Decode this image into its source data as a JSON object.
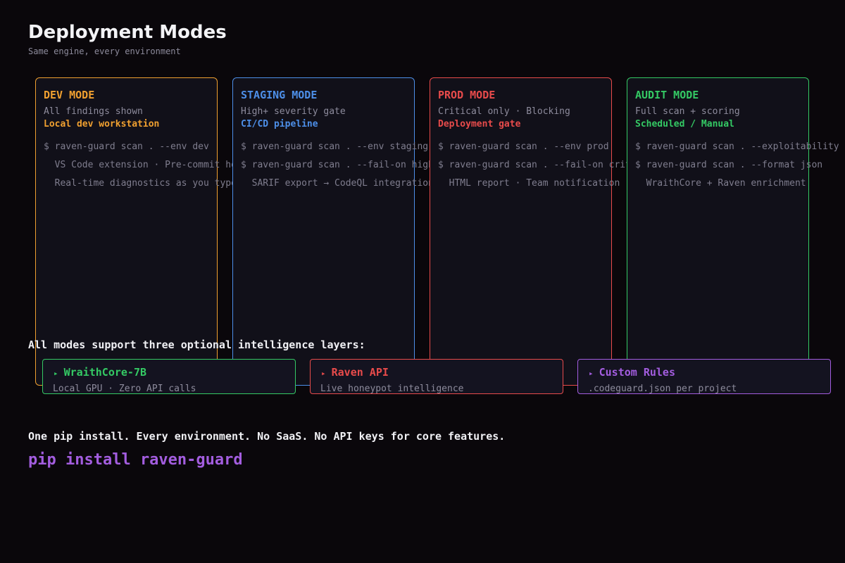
{
  "header": {
    "title": "Deployment Modes",
    "subtitle": "Same engine, every environment"
  },
  "colors": {
    "background": "#0a070b",
    "dev": "#f0a030",
    "staging": "#4d8fe8",
    "prod": "#e84b4b",
    "audit": "#34c964",
    "custom": "#a35ddf",
    "muted": "#8d8b9c"
  },
  "modes": [
    {
      "title": "DEV MODE",
      "desc": "All findings shown",
      "context": "Local dev workstation",
      "lines": [
        "$ raven-guard scan . --env dev",
        "  VS Code extension · Pre-commit hook",
        "  Real-time diagnostics as you type"
      ]
    },
    {
      "title": "STAGING MODE",
      "desc": "High+ severity gate",
      "context": "CI/CD pipeline",
      "lines": [
        "$ raven-guard scan . --env staging",
        "$ raven-guard scan . --fail-on high",
        "  SARIF export → CodeQL integration"
      ]
    },
    {
      "title": "PROD MODE",
      "desc": "Critical only · Blocking",
      "context": "Deployment gate",
      "lines": [
        "$ raven-guard scan . --env prod",
        "$ raven-guard scan . --fail-on critical",
        "  HTML report · Team notification"
      ]
    },
    {
      "title": "AUDIT MODE",
      "desc": "Full scan + scoring",
      "context": "Scheduled / Manual",
      "lines": [
        "$ raven-guard scan . --exploitability",
        "$ raven-guard scan . --format json",
        "  WraithCore + Raven enrichment"
      ]
    }
  ],
  "layers": {
    "heading": "All modes support three optional intelligence layers:",
    "items": [
      {
        "marker": "▸",
        "title": "WraithCore-7B",
        "desc": "Local GPU · Zero API calls"
      },
      {
        "marker": "▸",
        "title": "Raven API",
        "desc": "Live honeypot intelligence"
      },
      {
        "marker": "▸",
        "title": "Custom Rules",
        "desc": ".codeguard.json per project"
      }
    ]
  },
  "footer": {
    "tagline": "One pip install. Every environment. No SaaS. No API keys for core features.",
    "install": "pip install raven-guard"
  }
}
